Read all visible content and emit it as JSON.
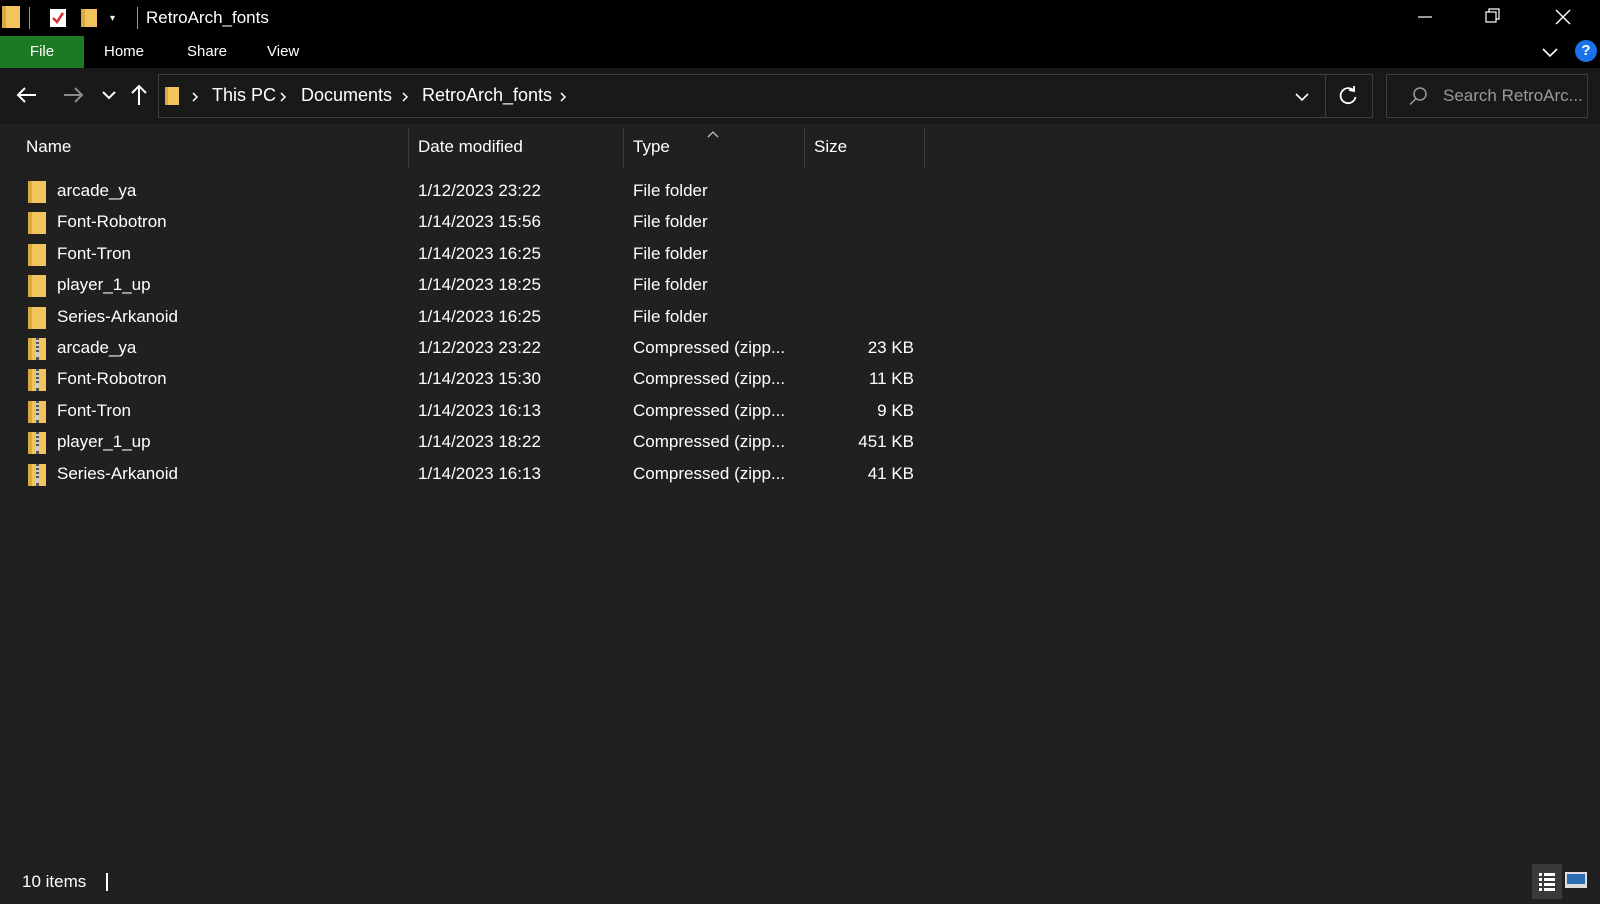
{
  "window": {
    "title": "RetroArch_fonts",
    "quick_access_dropdown": "▾"
  },
  "ribbon": {
    "tabs": [
      {
        "label": "File"
      },
      {
        "label": "Home"
      },
      {
        "label": "Share"
      },
      {
        "label": "View"
      }
    ],
    "help": "?"
  },
  "address_bar": {
    "breadcrumbs": [
      "This PC",
      "Documents",
      "RetroArch_fonts"
    ]
  },
  "search": {
    "placeholder": "Search RetroArc..."
  },
  "columns": [
    "Name",
    "Date modified",
    "Type",
    "Size"
  ],
  "files": [
    {
      "name": "arcade_ya",
      "date": "1/12/2023 23:22",
      "type": "File folder",
      "size": "",
      "icon": "folder-icon"
    },
    {
      "name": "Font-Robotron",
      "date": "1/14/2023 15:56",
      "type": "File folder",
      "size": "",
      "icon": "folder-icon"
    },
    {
      "name": "Font-Tron",
      "date": "1/14/2023 16:25",
      "type": "File folder",
      "size": "",
      "icon": "folder-icon"
    },
    {
      "name": "player_1_up",
      "date": "1/14/2023 18:25",
      "type": "File folder",
      "size": "",
      "icon": "folder-icon"
    },
    {
      "name": "Series-Arkanoid",
      "date": "1/14/2023 16:25",
      "type": "File folder",
      "size": "",
      "icon": "folder-icon"
    },
    {
      "name": "arcade_ya",
      "date": "1/12/2023 23:22",
      "type": "Compressed (zipp...",
      "size": "23 KB",
      "icon": "zip-folder-icon"
    },
    {
      "name": "Font-Robotron",
      "date": "1/14/2023 15:30",
      "type": "Compressed (zipp...",
      "size": "11 KB",
      "icon": "zip-folder-icon"
    },
    {
      "name": "Font-Tron",
      "date": "1/14/2023 16:13",
      "type": "Compressed (zipp...",
      "size": "9 KB",
      "icon": "zip-folder-icon"
    },
    {
      "name": "player_1_up",
      "date": "1/14/2023 18:22",
      "type": "Compressed (zipp...",
      "size": "451 KB",
      "icon": "zip-folder-icon"
    },
    {
      "name": "Series-Arkanoid",
      "date": "1/14/2023 16:13",
      "type": "Compressed (zipp...",
      "size": "41 KB",
      "icon": "zip-folder-icon"
    }
  ],
  "status": {
    "item_count": "10 items"
  },
  "colors": {
    "background": "#202020",
    "titlebar": "#000000",
    "file_tab": "#1c7a24",
    "folder": "#f2c55c",
    "help": "#1a73e8"
  }
}
